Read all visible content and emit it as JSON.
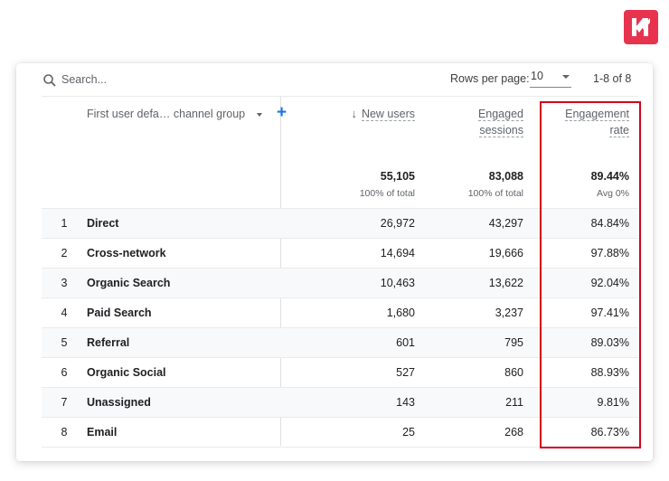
{
  "brand": {
    "logo_icon": "km-logo-icon",
    "logo_color": "#e8334f"
  },
  "toolbar": {
    "search_placeholder": "Search...",
    "rows_per_page_label": "Rows per page:",
    "rows_per_page_value": "10",
    "range_text": "1-8 of 8"
  },
  "table": {
    "dimension_label": "First user defa… channel group",
    "columns": [
      {
        "label_line1": "New users",
        "label_line2": "",
        "sorted": "descending",
        "total": "55,105",
        "total_sub": "100% of total"
      },
      {
        "label_line1": "Engaged",
        "label_line2": "sessions",
        "total": "83,088",
        "total_sub": "100% of total"
      },
      {
        "label_line1": "Engagement",
        "label_line2": "rate",
        "total": "89.44%",
        "total_sub": "Avg 0%"
      }
    ],
    "rows": [
      {
        "index": "1",
        "channel": "Direct",
        "new_users": "26,972",
        "engaged_sessions": "43,297",
        "engagement_rate": "84.84%"
      },
      {
        "index": "2",
        "channel": "Cross-network",
        "new_users": "14,694",
        "engaged_sessions": "19,666",
        "engagement_rate": "97.88%"
      },
      {
        "index": "3",
        "channel": "Organic Search",
        "new_users": "10,463",
        "engaged_sessions": "13,622",
        "engagement_rate": "92.04%"
      },
      {
        "index": "4",
        "channel": "Paid Search",
        "new_users": "1,680",
        "engaged_sessions": "3,237",
        "engagement_rate": "97.41%"
      },
      {
        "index": "5",
        "channel": "Referral",
        "new_users": "601",
        "engaged_sessions": "795",
        "engagement_rate": "89.03%"
      },
      {
        "index": "6",
        "channel": "Organic Social",
        "new_users": "527",
        "engaged_sessions": "860",
        "engagement_rate": "88.93%"
      },
      {
        "index": "7",
        "channel": "Unassigned",
        "new_users": "143",
        "engaged_sessions": "211",
        "engagement_rate": "9.81%"
      },
      {
        "index": "8",
        "channel": "Email",
        "new_users": "25",
        "engaged_sessions": "268",
        "engagement_rate": "86.73%"
      }
    ]
  },
  "annotation": {
    "highlight_column": "Engagement rate",
    "highlight_color": "#d0021b"
  }
}
